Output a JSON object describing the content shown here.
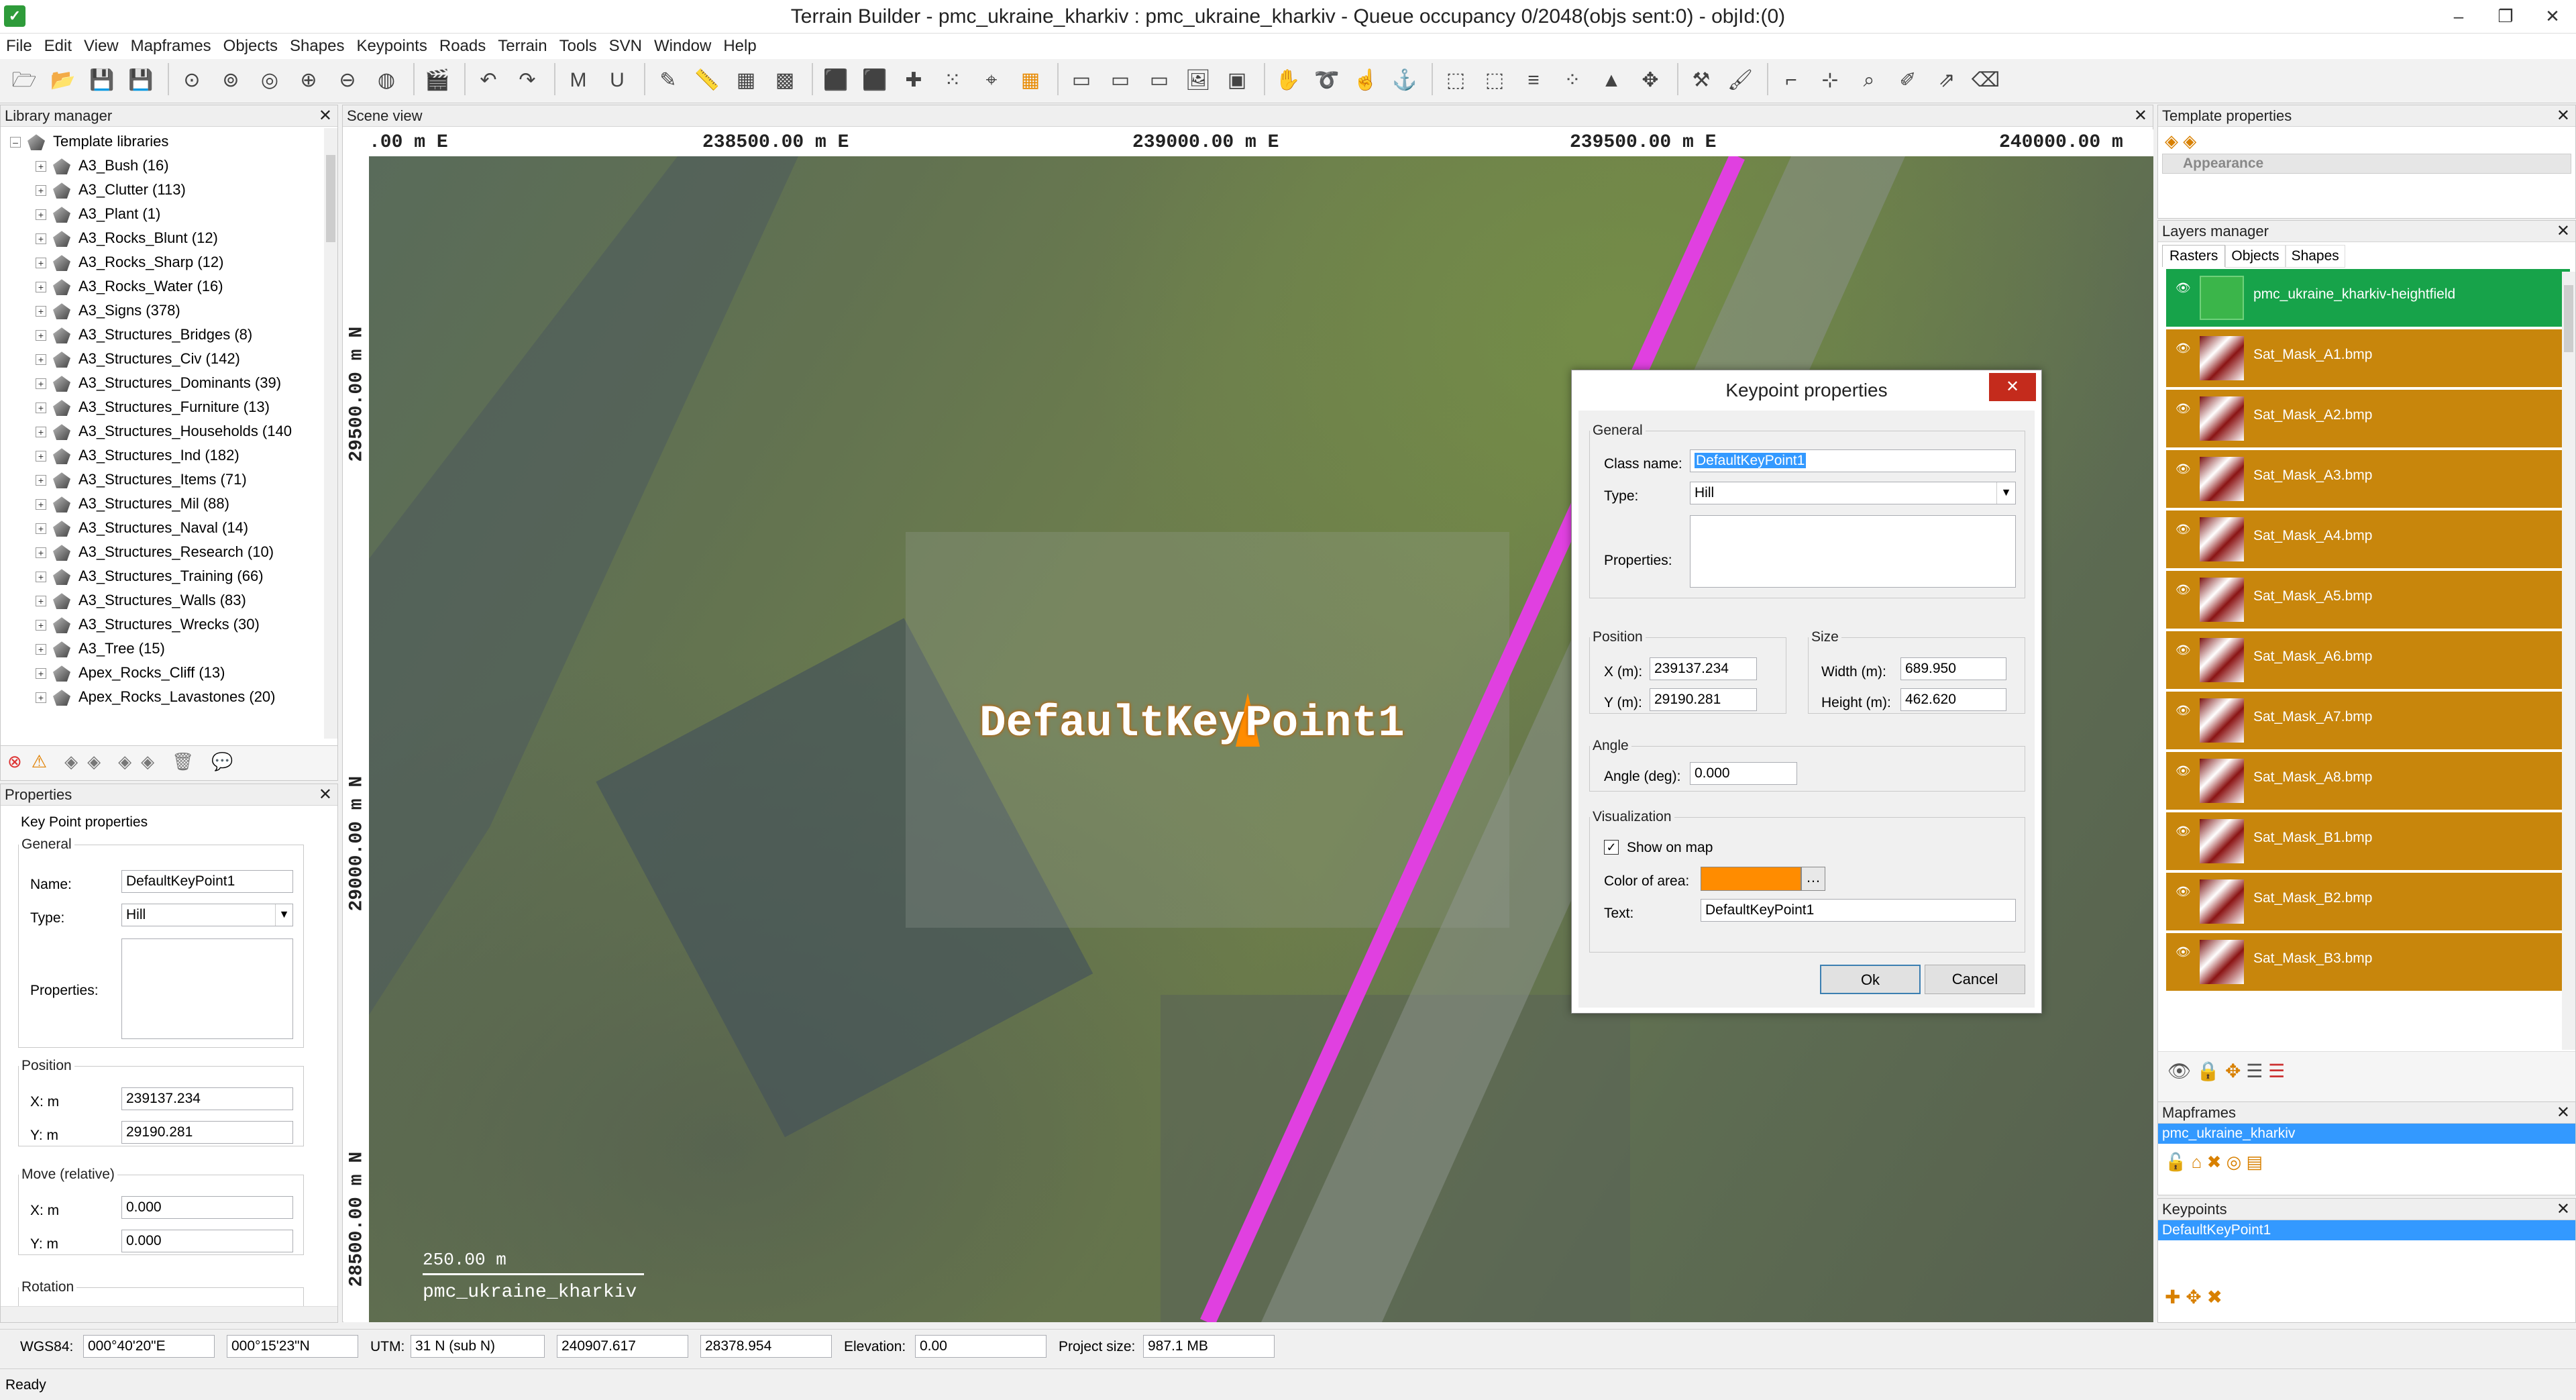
{
  "window": {
    "title": "Terrain Builder - pmc_ukraine_kharkiv : pmc_ukraine_kharkiv - Queue occupancy 0/2048(objs sent:0) - objId:(0)"
  },
  "menu": [
    "File",
    "Edit",
    "View",
    "Mapframes",
    "Objects",
    "Shapes",
    "Keypoints",
    "Roads",
    "Terrain",
    "Tools",
    "SVN",
    "Window",
    "Help"
  ],
  "library": {
    "title": "Library manager",
    "root": "Template libraries",
    "items": [
      "A3_Bush (16)",
      "A3_Clutter (113)",
      "A3_Plant (1)",
      "A3_Rocks_Blunt (12)",
      "A3_Rocks_Sharp (12)",
      "A3_Rocks_Water (16)",
      "A3_Signs (378)",
      "A3_Structures_Bridges (8)",
      "A3_Structures_Civ (142)",
      "A3_Structures_Dominants (39)",
      "A3_Structures_Furniture (13)",
      "A3_Structures_Households (140",
      "A3_Structures_Ind (182)",
      "A3_Structures_Items (71)",
      "A3_Structures_Mil (88)",
      "A3_Structures_Naval (14)",
      "A3_Structures_Research (10)",
      "A3_Structures_Training (66)",
      "A3_Structures_Walls (83)",
      "A3_Structures_Wrecks (30)",
      "A3_Tree (15)",
      "Apex_Rocks_Cliff (13)",
      "Apex_Rocks_Lavastones (20)"
    ]
  },
  "properties": {
    "title": "Properties",
    "section": "Key Point properties",
    "general": "General",
    "name_label": "Name:",
    "name": "DefaultKeyPoint1",
    "type_label": "Type:",
    "type": "Hill",
    "props_label": "Properties:",
    "position": "Position",
    "x_label": "X: m",
    "x": "239137.234",
    "y_label": "Y: m",
    "y": "29190.281",
    "move": "Move (relative)",
    "mx_label": "X: m",
    "mx": "0.000",
    "my_label": "Y: m",
    "my": "0.000",
    "rotation": "Rotation"
  },
  "scene": {
    "title": "Scene view",
    "top_ticks": [
      ".00 m E",
      "238500.00 m E",
      "239000.00 m E",
      "239500.00 m E",
      "240000.00 m"
    ],
    "left_ticks": [
      "29500.00 m N",
      "29000.00 m N",
      "28500.00 m N"
    ],
    "keypoint_label": "DefaultKeyPoint1",
    "scale_text": "250.00 m",
    "map_name": "pmc_ukraine_kharkiv"
  },
  "dialog": {
    "title": "Keypoint properties",
    "general": "General",
    "class_label": "Class name:",
    "class_value": "DefaultKeyPoint1",
    "type_label": "Type:",
    "type_value": "Hill",
    "props_label": "Properties:",
    "position": "Position",
    "x_label": "X (m):",
    "x": "239137.234",
    "y_label": "Y (m):",
    "y": "29190.281",
    "size": "Size",
    "w_label": "Width (m):",
    "w": "689.950",
    "h_label": "Height (m):",
    "h": "462.620",
    "angle": "Angle",
    "angle_label": "Angle (deg):",
    "angle_value": "0.000",
    "vis": "Visualization",
    "show_label": "Show on map",
    "color_label": "Color of area:",
    "color": "#ff8c00",
    "text_label": "Text:",
    "text_value": "DefaultKeyPoint1",
    "ok": "Ok",
    "cancel": "Cancel"
  },
  "template": {
    "title": "Template properties",
    "appearance": "Appearance"
  },
  "layers": {
    "title": "Layers manager",
    "tabs": [
      "Rasters",
      "Objects",
      "Shapes"
    ],
    "heightfield": "pmc_ukraine_kharkiv-heightfield",
    "masks": [
      "Sat_Mask_A1.bmp",
      "Sat_Mask_A2.bmp",
      "Sat_Mask_A3.bmp",
      "Sat_Mask_A4.bmp",
      "Sat_Mask_A5.bmp",
      "Sat_Mask_A6.bmp",
      "Sat_Mask_A7.bmp",
      "Sat_Mask_A8.bmp",
      "Sat_Mask_B1.bmp",
      "Sat_Mask_B2.bmp",
      "Sat_Mask_B3.bmp"
    ]
  },
  "mapframes": {
    "title": "Mapframes",
    "item": "pmc_ukraine_kharkiv"
  },
  "keypoints": {
    "title": "Keypoints",
    "item": "DefaultKeyPoint1"
  },
  "status": {
    "wgs_label": "WGS84:",
    "lat": "000°40'20\"E",
    "lon": "000°15'23\"N",
    "utm_label": "UTM:",
    "zone": "31 N (sub N)",
    "e": "240907.617",
    "n": "28378.954",
    "elev_label": "Elevation:",
    "elev": "0.00",
    "size_label": "Project size:",
    "size": "987.1 MB",
    "ready": "Ready"
  }
}
